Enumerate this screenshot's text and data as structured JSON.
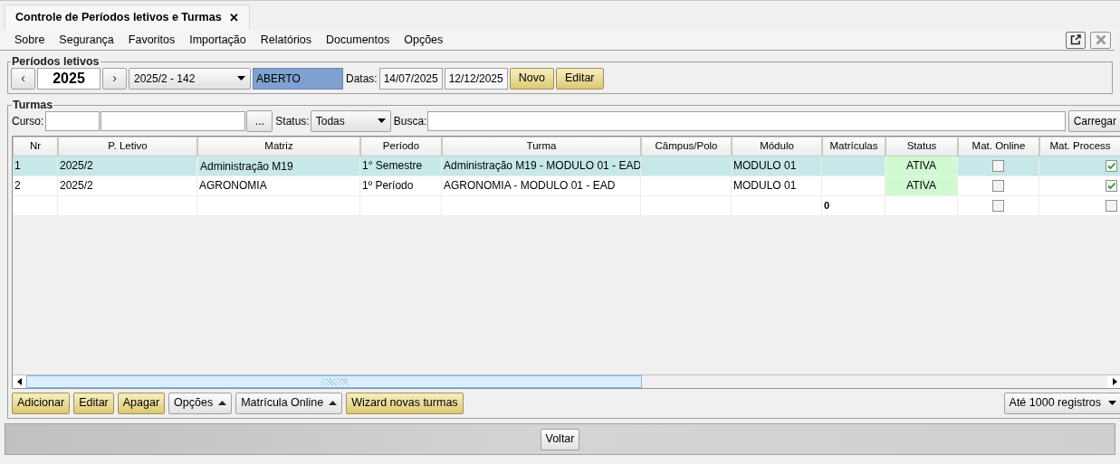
{
  "tab": {
    "title": "Controle de Períodos letivos e Turmas",
    "close": "✕"
  },
  "menu": [
    "Sobre",
    "Segurança",
    "Favoritos",
    "Importação",
    "Relatórios",
    "Documentos",
    "Opções"
  ],
  "periodos": {
    "legend": "Períodos letivos",
    "prev": "‹",
    "year": "2025",
    "next": "›",
    "period": "2025/2 - 142",
    "state": "ABERTO",
    "dates_label": "Datas:",
    "date_start": "14/07/2025",
    "date_end": "12/12/2025",
    "buttons": [
      "Novo",
      "Editar"
    ]
  },
  "turmas": {
    "legend": "Turmas",
    "curso_label": "Curso:",
    "browse": "...",
    "status_label": "Status:",
    "status_value": "Todas",
    "busca_label": "Busca:",
    "load": "Carregar",
    "table": {
      "columns": [
        "Nr",
        "P. Letivo",
        "Matriz",
        "Período",
        "Turma",
        "Câmpus/Polo",
        "Módulo",
        "Matrículas",
        "Status",
        "Mat. Online",
        "Mat. Process"
      ],
      "rows": [
        {
          "selected": true,
          "matriz_focused": true,
          "nr": "1",
          "p_letivo": "2025/2",
          "matriz": "Administração M19",
          "periodo": "1° Semestre",
          "turma": "Administração M19 - MODULO 01 - EAD",
          "modulo": "MODULO 01",
          "status": "ATIVA",
          "mat_online": false,
          "mat_process": true
        },
        {
          "selected": false,
          "nr": "2",
          "p_letivo": "2025/2",
          "matriz": "AGRONOMIA",
          "periodo": "1º Período",
          "turma": "AGRONOMIA - MODULO 01 - EAD",
          "modulo": "MODULO 01",
          "status": "ATIVA",
          "mat_online": false,
          "mat_process": true
        },
        {
          "selected": false,
          "kind": "total",
          "matriculas": "0",
          "mat_online": false,
          "mat_process": false
        }
      ]
    },
    "actions": [
      {
        "label": "Adicionar",
        "kind": "primary"
      },
      {
        "label": "Editar",
        "kind": "primary"
      },
      {
        "label": "Apagar",
        "kind": "primary"
      },
      {
        "label": "Opções",
        "kind": "menu"
      },
      {
        "label": "Matrícula Online",
        "kind": "menu"
      },
      {
        "label": "Wizard novas turmas",
        "kind": "primary"
      }
    ],
    "limit": "Até 1000 registros"
  },
  "footer": {
    "back": "Voltar"
  }
}
